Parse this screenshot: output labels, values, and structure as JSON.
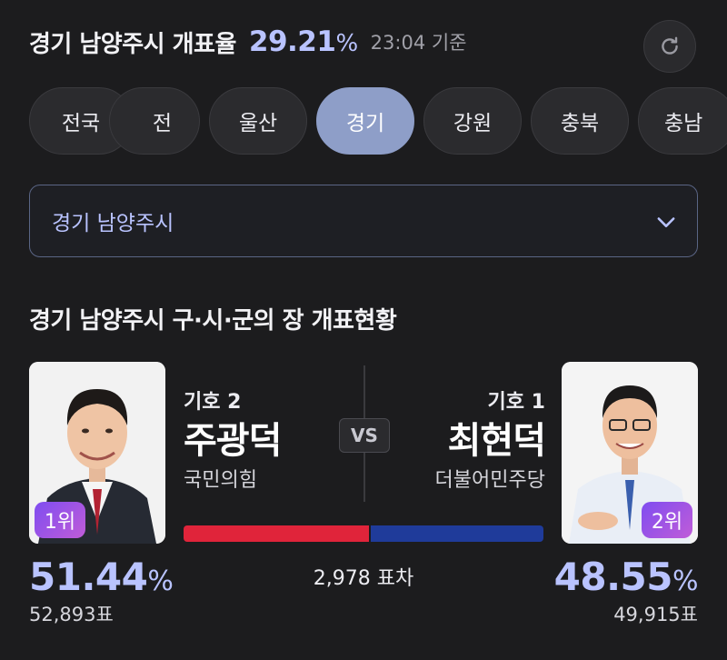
{
  "header": {
    "title": "경기 남양주시 개표율",
    "rate": "29.21",
    "rate_unit": "%",
    "time": "23:04 기준"
  },
  "tabs": [
    "전국",
    "전",
    "울산",
    "경기",
    "강원",
    "충북",
    "충남"
  ],
  "active_tab": "경기",
  "dropdown": {
    "value": "경기 남양주시"
  },
  "section_title": "경기 남양주시 구·시·군의 장 개표현황",
  "candidates": [
    {
      "number": "기호 2",
      "name": "주광덕",
      "party": "국민의힘",
      "rank": "1위",
      "percent": "51.44",
      "percent_unit": "%",
      "votes": "52,893표",
      "share": 51.44,
      "color": "#e0243a"
    },
    {
      "number": "기호 1",
      "name": "최현덕",
      "party": "더불어민주당",
      "rank": "2위",
      "percent": "48.55",
      "percent_unit": "%",
      "votes": "49,915표",
      "share": 48.55,
      "color": "#1f3b9a"
    }
  ],
  "vs_label": "VS",
  "diff": "2,978 표차",
  "colors": {
    "accent": "#b9c3ff",
    "active_tab": "#8e9ec8",
    "badge_gradient_start": "#7f4df0",
    "badge_gradient_end": "#c05cd8"
  },
  "icons": {
    "refresh": "refresh-icon",
    "dropdown": "chevron-down-icon"
  }
}
